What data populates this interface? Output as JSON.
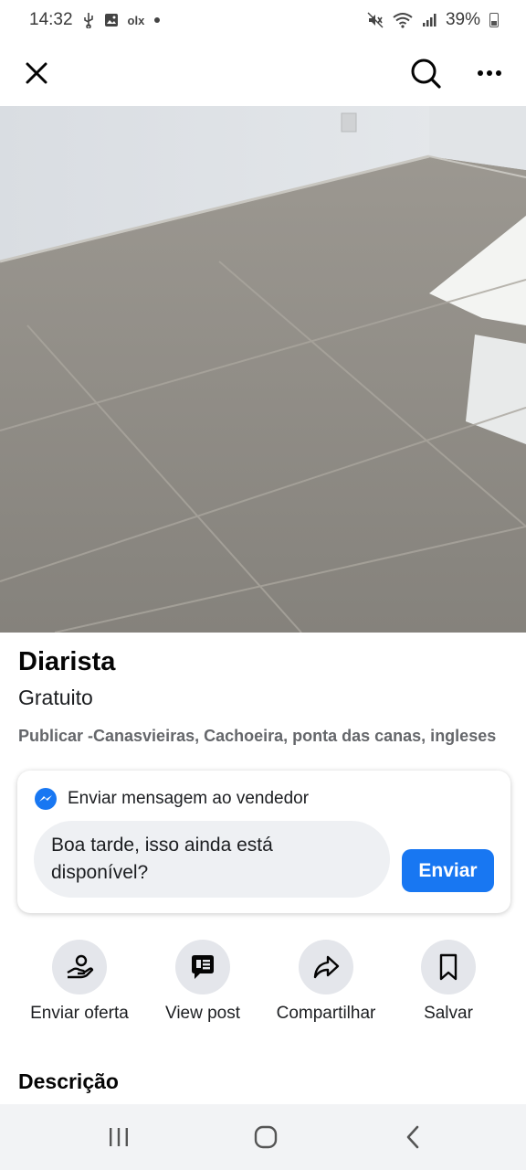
{
  "status_bar": {
    "time": "14:32",
    "battery": "39%",
    "icons": [
      "usb-icon",
      "image-icon",
      "olx-icon",
      "dot-icon",
      "mute-icon",
      "wifi-icon",
      "signal-icon",
      "battery-icon"
    ],
    "olx_label": "olx"
  },
  "top_bar": {
    "icons": [
      "close-icon",
      "search-icon",
      "more-icon"
    ]
  },
  "photo": {
    "pager_count": 3,
    "pager_active_index": 1
  },
  "listing": {
    "title": "Diarista",
    "price": "Gratuito",
    "location": "Publicar -Canasvieiras, Cachoeira, ponta das canas, ingleses"
  },
  "message": {
    "header": "Enviar mensagem ao vendedor",
    "text": "Boa tarde, isso ainda está disponível?",
    "send_label": "Enviar",
    "accent": "#1877f2"
  },
  "actions": [
    {
      "label": "Enviar oferta",
      "icon": "offer-icon"
    },
    {
      "label": "View post",
      "icon": "post-icon"
    },
    {
      "label": "Compartilhar",
      "icon": "share-icon"
    },
    {
      "label": "Salvar",
      "icon": "bookmark-icon"
    }
  ],
  "description": {
    "title": "Descrição"
  },
  "nav_bar": {
    "icons": [
      "recents-icon",
      "home-icon",
      "back-icon"
    ]
  }
}
